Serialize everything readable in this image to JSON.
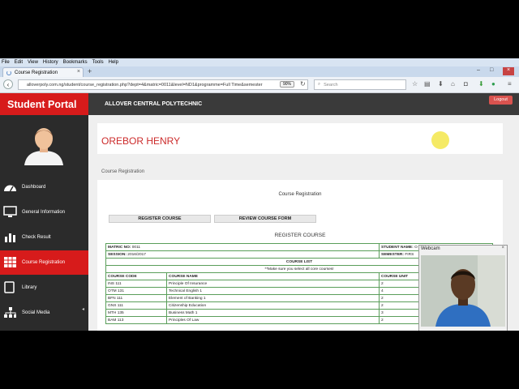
{
  "browser": {
    "menu": [
      "File",
      "Edit",
      "View",
      "History",
      "Bookmarks",
      "Tools",
      "Help"
    ],
    "tab_title": "Course Registration",
    "url": "alloverpoly.com.ng/student/course_registration.php?dept=4&matric=0011&level=ND1&programme=Full Time&semester",
    "zoom": "90%",
    "search_placeholder": "Search"
  },
  "header": {
    "brand": "Student Portal",
    "institution": "ALLOVER CENTRAL POLYTECHNIC",
    "logout": "Logout"
  },
  "sidebar": {
    "items": [
      {
        "label": "Dashboard",
        "icon": "dashboard-icon"
      },
      {
        "label": "General Information",
        "icon": "monitor-icon"
      },
      {
        "label": "Check Result",
        "icon": "bar-chart-icon"
      },
      {
        "label": "Course Registration",
        "icon": "table-icon",
        "active": true
      },
      {
        "label": "Library",
        "icon": "book-icon"
      },
      {
        "label": "Social Media",
        "icon": "share-icon"
      }
    ]
  },
  "main": {
    "student_name": "OREBOR HENRY",
    "breadcrumb": "Course Registration",
    "section_title": "Course Registration",
    "register_button": "REGISTER COURSE",
    "review_button": "REVIEW COURSE FORM",
    "register_title": "REGISTER COURSE",
    "form": {
      "matric_label": "MATRIC NO:",
      "matric_value": "0011",
      "student_name_label": "STUDENT NAME:",
      "student_name_value": "O",
      "session_label": "SESSION:",
      "session_value": "2016/2017",
      "semester_label": "SEMESTER:",
      "semester_value": "FIRS",
      "course_list_title": "COURSE LIST",
      "course_list_note": "**Make sure you select all core courses!",
      "headers": [
        "COURSE CODE",
        "COURSE NAME",
        "COURSE UNIT"
      ],
      "rows": [
        [
          "INS 111",
          "Principle Of Insurance",
          "2"
        ],
        [
          "OTM 131",
          "Technical English 1",
          "4"
        ],
        [
          "BFN 111",
          "Element of Banking 1",
          "2"
        ],
        [
          "GNS 111",
          "Citizenship Education",
          "2"
        ],
        [
          "MTH 135",
          "Business Math 1",
          "3"
        ],
        [
          "BAM 113",
          "Principles Of Law",
          "2"
        ]
      ]
    }
  },
  "webcam": {
    "title": "Webcam"
  }
}
